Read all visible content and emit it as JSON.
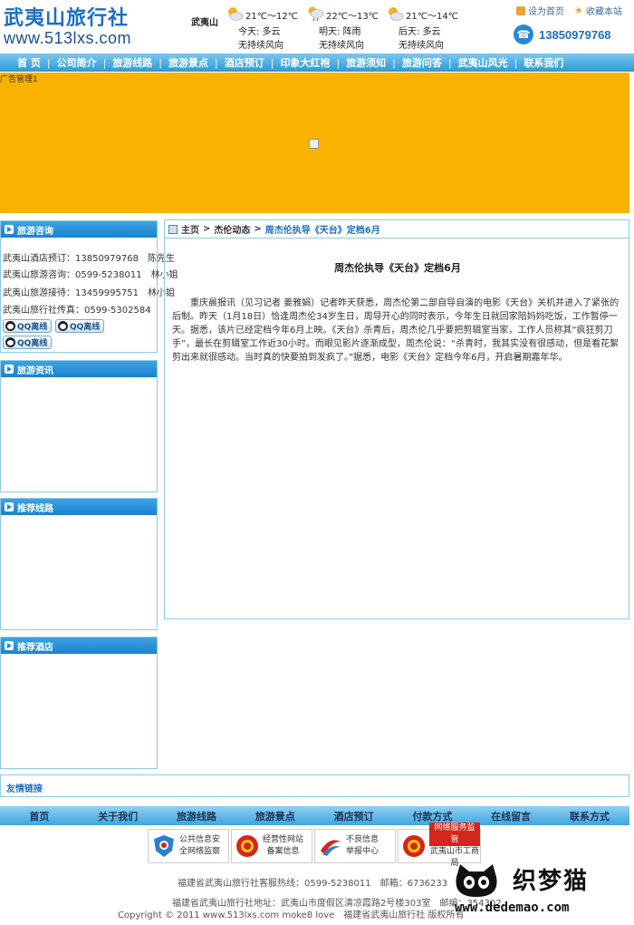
{
  "header": {
    "logo_cn": "武夷山旅行社",
    "logo_url": "www.513lxs.com",
    "weather_city": "武夷山",
    "weather": [
      {
        "temp": "21℃～12℃",
        "day": "今天: 多云",
        "wind": "无持续风向",
        "icon": "cloudy-sun-icon"
      },
      {
        "temp": "22℃～13℃",
        "day": "明天: 阵雨",
        "wind": "无持续风向",
        "icon": "shower-icon"
      },
      {
        "temp": "21℃～14℃",
        "day": "后天: 多云",
        "wind": "无持续风向",
        "icon": "cloudy-sun-icon"
      }
    ],
    "set_home": "设为首页",
    "bookmark": "收藏本站",
    "phone": "13850979768"
  },
  "nav": [
    "首 页",
    "公司简介",
    "旅游线路",
    "旅游景点",
    "酒店预订",
    "印象大红袍",
    "旅游须知",
    "旅游问答",
    "武夷山风光",
    "联系我们"
  ],
  "banner": {
    "label": "广告管理1"
  },
  "sidebar": {
    "consult": {
      "title": "旅游咨询",
      "rows": [
        "武夷山酒店预订：13850979768　陈先生",
        "武夷山旅游咨询：0599-5238011　林小姐",
        "武夷山旅游接待：13459995751　林小姐",
        "武夷山旅行社传真：0599-5302584"
      ],
      "qq_label": "QQ离线"
    },
    "news": {
      "title": "旅游资讯"
    },
    "routes": {
      "title": "推荐线路"
    },
    "hotels": {
      "title": "推荐酒店"
    }
  },
  "main": {
    "breadcrumb": [
      "主页",
      "杰伦动态",
      "周杰伦执导《天台》定档6月"
    ],
    "title": "周杰伦执导《天台》定档6月",
    "body": "重庆晨报讯（见习记者 姜雅娟）记者昨天获悉，周杰伦第二部自导自演的电影《天台》关机并进入了紧张的后制。昨天（1月18日）恰逢周杰伦34岁生日，周导开心的同时表示，今年生日就回家陪妈妈吃饭，工作暂停一天。据悉，该片已经定档今年6月上映。《天台》杀青后，周杰伦几乎要把剪辑室当家，工作人员称其“疯狂剪刀手”，最长在剪辑室工作近30小时。而眼见影片逐渐成型，周杰伦说：“杀青时，我其实没有很感动，但是看花絮剪出来就很感动。当时真的快要拍到发疯了。”据悉，电影《天台》定档今年6月，开启暑期嘉年华。"
  },
  "friends": {
    "title": "友情链接"
  },
  "footer_nav": [
    "首页",
    "关于我们",
    "旅游线路",
    "旅游景点",
    "酒店预订",
    "付款方式",
    "在线留言",
    "联系方式"
  ],
  "badges": [
    {
      "line1": "公共信息安",
      "line2": "全网络监察",
      "icon": "police-shield-icon",
      "color": "#2a7fd0"
    },
    {
      "line1": "经营性网站",
      "line2": "备案信息",
      "icon": "red-emblem-icon",
      "color": "#d4261c"
    },
    {
      "line1": "不良信息",
      "line2": "举报中心",
      "icon": "report-swoosh-icon",
      "color": "#d4261c"
    },
    {
      "line1": "网络服务监管",
      "line2": "武夷山市工商局",
      "icon": "red-emblem-icon",
      "color": "#d4261c"
    }
  ],
  "footer": {
    "hotline": "福建省武夷山旅行社客服热线：0599-5238011　邮箱：6736233",
    "address": "福建省武夷山旅行社地址：武夷山市度假区清凉霞路2号楼303室　邮编：354302",
    "copyright": "Copyright © 2011 www.513lxs.com moke8 love　福建省武夷山旅行社 版权所有"
  },
  "watermark": {
    "cn": "织梦猫",
    "url": "www.dedemao.com"
  }
}
